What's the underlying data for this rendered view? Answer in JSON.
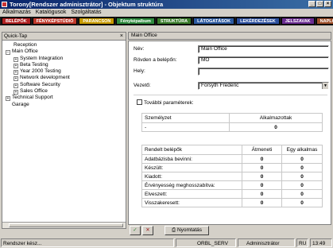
{
  "window": {
    "title": "Torony[Rendszer adminisztrátor] - Objektum struktúra"
  },
  "menu": {
    "items": [
      "Alkalmazás",
      "Katalógusok",
      "Szolgáltatás"
    ]
  },
  "tabs": [
    {
      "label": "BELÉPŐK",
      "color": "#b22222"
    },
    {
      "label": "FÉNYKÉPSTÚDIÓ",
      "color": "#c0392b"
    },
    {
      "label": "PARANCSON",
      "color": "#c79a00"
    },
    {
      "label": "Fényképalbum",
      "color": "#2e8b3e"
    },
    {
      "label": "STRUKTÚRA",
      "color": "#3a7d2c"
    },
    {
      "label": "LÁTOGATÁSOK",
      "color": "#2c5aa0"
    },
    {
      "label": "LEKÉRDEZÉSEK",
      "color": "#2b4f9e"
    },
    {
      "label": "JELSZAVAK",
      "color": "#6a2c91"
    },
    {
      "label": "NAPLÓ",
      "color": "#a0522d"
    }
  ],
  "left_panel": {
    "title": "Quick-Tap",
    "close": "×",
    "tree": [
      {
        "label": "Reception",
        "level": 1,
        "expander": ""
      },
      {
        "label": "Main Office",
        "level": 0,
        "expander": "⊟"
      },
      {
        "label": "System Integration",
        "level": 1,
        "expander": "⊞"
      },
      {
        "label": "Beta Testing",
        "level": 1,
        "expander": "⊞"
      },
      {
        "label": "Year 2000 Testing",
        "level": 1,
        "expander": "⊞"
      },
      {
        "label": "Network development",
        "level": 1,
        "expander": "⊞"
      },
      {
        "label": "Software Security",
        "level": 1,
        "expander": "⊞"
      },
      {
        "label": "Sales Office",
        "level": 1,
        "expander": "⊞"
      },
      {
        "label": "Technical Support",
        "level": 0,
        "expander": "⊞"
      },
      {
        "label": "Garage",
        "level": 0,
        "expander": ""
      }
    ]
  },
  "right_panel": {
    "title": "Main Office",
    "fields": {
      "nev_label": "Név:",
      "nev_value": "Main Office",
      "rovid_label": "Rövden a belépőn:",
      "rovid_value": "MO",
      "hely_label": "Hely:",
      "hely_value": "",
      "vezeto_label": "Vezető:",
      "vezeto_value": "Forsyth Frederic"
    },
    "more_params_label": "További paraméterek:",
    "staff_table": {
      "col1": "Személyzet",
      "col2": "Alkalmazottak",
      "row_c1": "-",
      "row_c2": "0"
    },
    "access_table": {
      "col1": "Rendelt belépők",
      "col2": "Átmeneti",
      "col3": "Egy alkalmas",
      "rows": [
        {
          "label": "Adatbázisba bevinni:",
          "a": "0",
          "b": "0"
        },
        {
          "label": "Készült:",
          "a": "0",
          "b": "0"
        },
        {
          "label": "Kiadott:",
          "a": "0",
          "b": "0"
        },
        {
          "label": "Érvényesség meghosszabítva:",
          "a": "0",
          "b": "0"
        },
        {
          "label": "Elveszett:",
          "a": "0",
          "b": "0"
        },
        {
          "label": "Visszakeresett:",
          "a": "0",
          "b": "0"
        }
      ]
    },
    "footer": {
      "ok": "✓",
      "cancel": "✕",
      "print": "Nyomtatás"
    }
  },
  "statusbar": {
    "message": "Rendszer kész...",
    "server": "ORBL_SERV",
    "user": "Adminisztrátor",
    "lang": "RU",
    "time": "13:49"
  }
}
